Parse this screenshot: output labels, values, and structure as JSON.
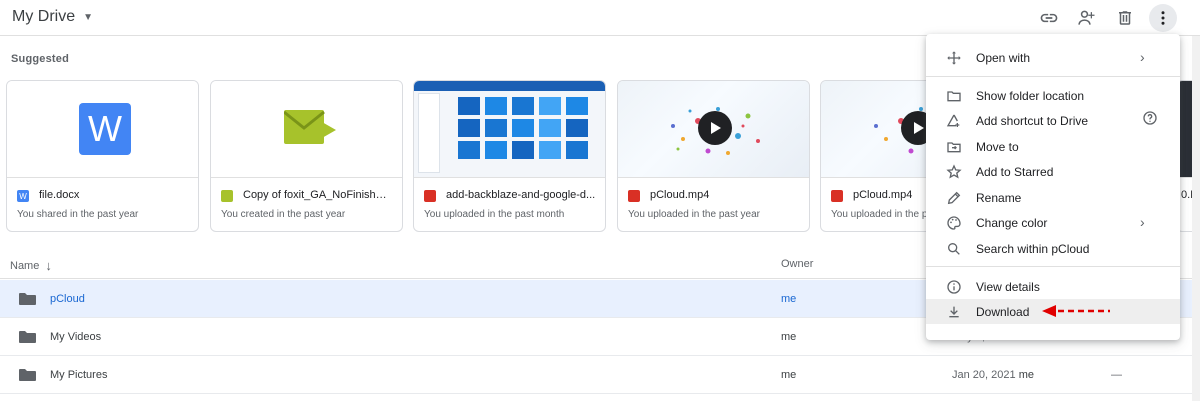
{
  "header": {
    "title": "My Drive",
    "toolbar": {
      "link_icon": "link-icon",
      "share_icon": "add-person-icon",
      "trash_icon": "trash-icon",
      "more_icon": "more-vertical-icon"
    }
  },
  "suggested": {
    "label": "Suggested",
    "cards": [
      {
        "name": "file.docx",
        "sub": "You shared in the past year",
        "type": "docx"
      },
      {
        "name": "Copy of foxit_GA_NoFinishPa...",
        "sub": "You created in the past year",
        "type": "form"
      },
      {
        "name": "add-backblaze-and-google-d...",
        "sub": "You uploaded in the past month",
        "type": "image"
      },
      {
        "name": "pCloud.mp4",
        "sub": "You uploaded in the past year",
        "type": "video"
      },
      {
        "name": "pCloud.mp4",
        "sub": "You uploaded in the past ye",
        "type": "video"
      },
      {
        "name": "0.I",
        "sub": "",
        "type": "video"
      }
    ]
  },
  "list": {
    "headers": {
      "name": "Name",
      "owner": "Owner"
    },
    "rows": [
      {
        "name": "pCloud",
        "owner": "me",
        "date": "",
        "date_owner": "",
        "size": "",
        "selected": true
      },
      {
        "name": "My Videos",
        "owner": "me",
        "date": "May 6, 2021",
        "date_owner": "me",
        "size": "",
        "selected": false
      },
      {
        "name": "My Pictures",
        "owner": "me",
        "date": "Jan 20, 2021",
        "date_owner": "me",
        "size": "—",
        "selected": false
      }
    ]
  },
  "context_menu": {
    "items": [
      {
        "label": "Open with",
        "icon": "move-arrows-icon",
        "right": "›"
      },
      {
        "label": "Show folder location",
        "icon": "folder-outline-icon",
        "right": ""
      },
      {
        "label": "Add shortcut to Drive",
        "icon": "add-shortcut-icon",
        "right": "?"
      },
      {
        "label": "Move to",
        "icon": "move-to-icon",
        "right": ""
      },
      {
        "label": "Add to Starred",
        "icon": "star-icon",
        "right": ""
      },
      {
        "label": "Rename",
        "icon": "pencil-icon",
        "right": ""
      },
      {
        "label": "Change color",
        "icon": "palette-icon",
        "right": "›"
      },
      {
        "label": "Search within pCloud",
        "icon": "search-icon",
        "right": ""
      },
      {
        "label": "View details",
        "icon": "info-icon",
        "right": ""
      },
      {
        "label": "Download",
        "icon": "download-icon",
        "right": ""
      }
    ],
    "highlighted": "Download",
    "annotation_color": "#e00000"
  },
  "colors": {
    "word_blue": "#4285f4",
    "form_green": "#a7c22b",
    "image_red": "#d93025",
    "selected_bg": "#e8f0fe",
    "selected_text": "#1967d2"
  }
}
